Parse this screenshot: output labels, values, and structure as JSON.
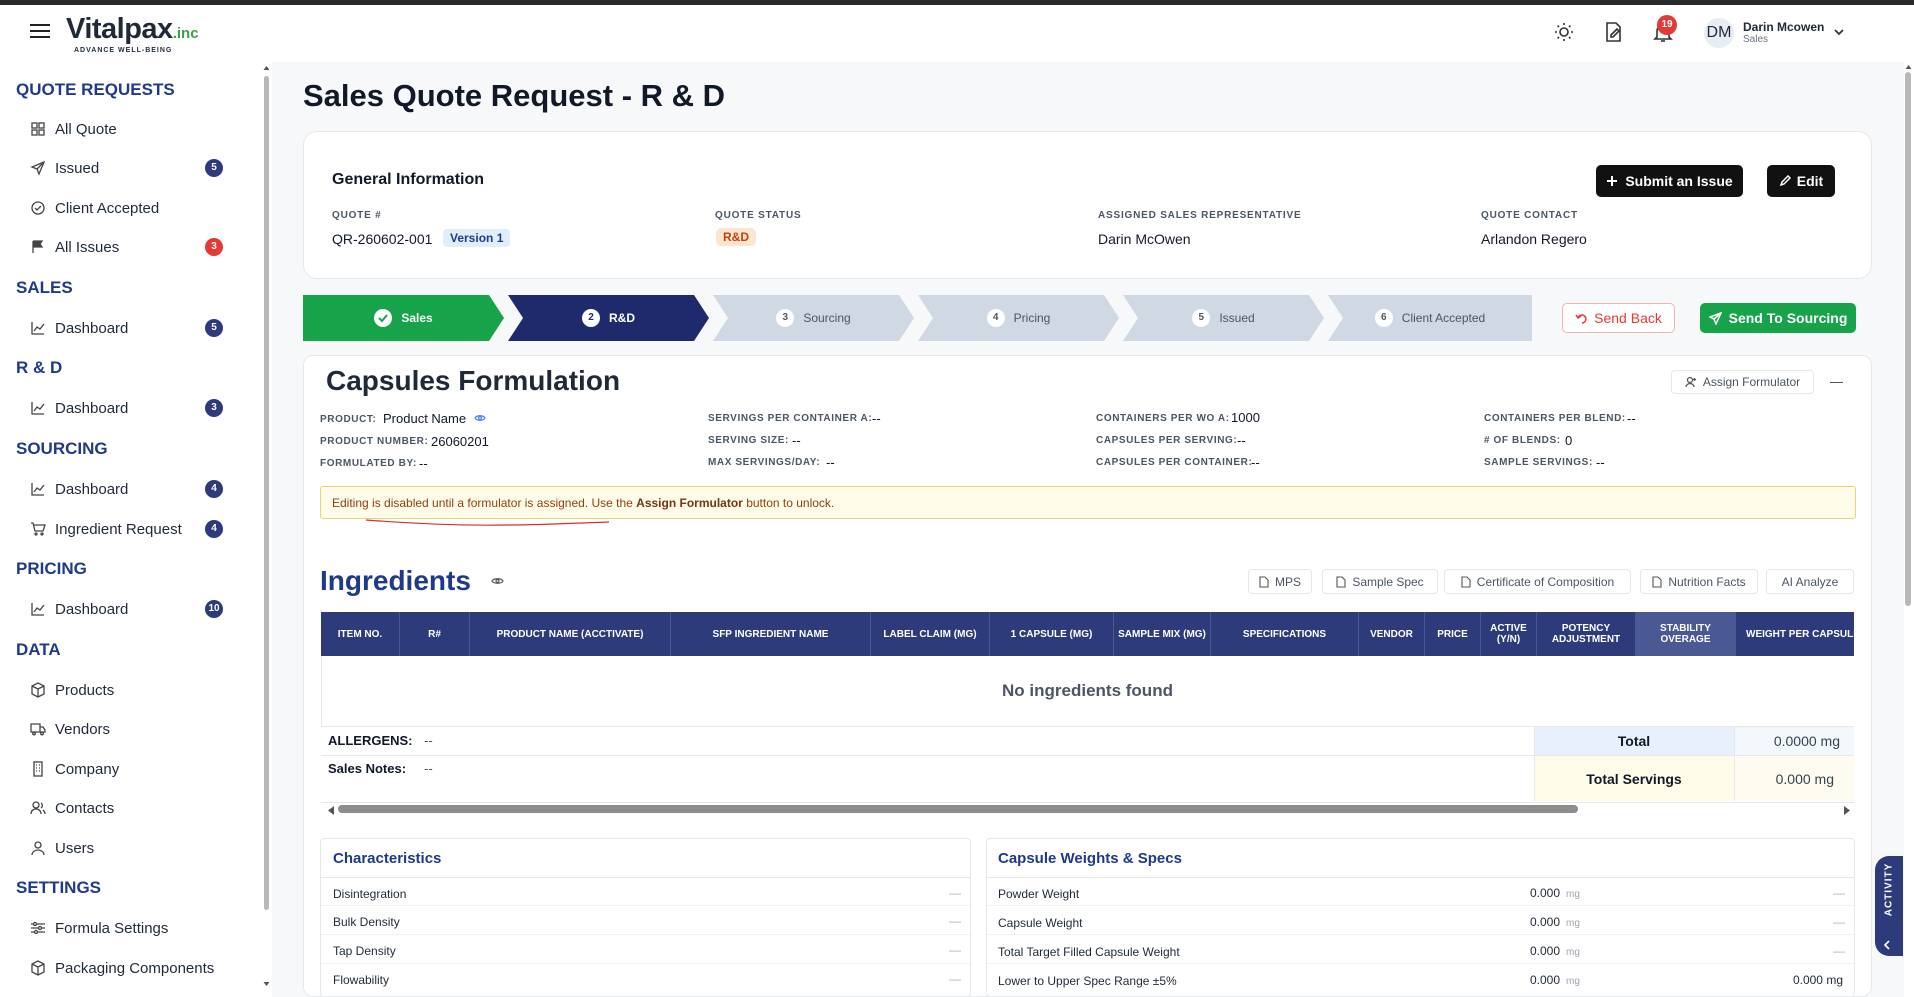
{
  "header": {
    "logo_text": "Vitalpax",
    "logo_suffix": ".inc",
    "logo_tagline": "ADVANCE WELL-BEING",
    "notification_count": "19",
    "user_initials": "DM",
    "user_name": "Darin Mcowen",
    "user_role": "Sales"
  },
  "sidebar": {
    "quote_requests": "QUOTE REQUESTS",
    "all_quote": "All Quote",
    "issued": "Issued",
    "issued_count": "5",
    "client_accepted": "Client Accepted",
    "all_issues": "All Issues",
    "all_issues_count": "3",
    "sales": "SALES",
    "sales_dashboard": "Dashboard",
    "sales_count": "5",
    "rnd": "R & D",
    "rnd_dashboard": "Dashboard",
    "rnd_count": "3",
    "sourcing": "SOURCING",
    "sourcing_dashboard": "Dashboard",
    "sourcing_count": "4",
    "ingredient_request": "Ingredient Request",
    "ingredient_request_count": "4",
    "pricing": "PRICING",
    "pricing_dashboard": "Dashboard",
    "pricing_count": "10",
    "data": "DATA",
    "products": "Products",
    "vendors": "Vendors",
    "company": "Company",
    "contacts": "Contacts",
    "users": "Users",
    "settings": "SETTINGS",
    "formula_settings": "Formula Settings",
    "packaging_components": "Packaging Components"
  },
  "page": {
    "title": "Sales Quote Request - R & D"
  },
  "general_info": {
    "title": "General Information",
    "submit_issue": "Submit an Issue",
    "edit": "Edit",
    "quote_no_label": "QUOTE #",
    "quote_no": "QR-260602-001",
    "version": "Version 1",
    "status_label": "QUOTE STATUS",
    "status": "R&D",
    "rep_label": "ASSIGNED SALES REPRESENTATIVE",
    "rep": "Darin McOwen",
    "contact_label": "QUOTE CONTACT",
    "contact": "Arlandon Regero"
  },
  "steps": [
    {
      "num": "",
      "label": "Sales"
    },
    {
      "num": "2",
      "label": "R&D"
    },
    {
      "num": "3",
      "label": "Sourcing"
    },
    {
      "num": "4",
      "label": "Pricing"
    },
    {
      "num": "5",
      "label": "Issued"
    },
    {
      "num": "6",
      "label": "Client Accepted"
    }
  ],
  "actions": {
    "send_back": "Send Back",
    "send_to_sourcing": "Send To Sourcing"
  },
  "formulation": {
    "title": "Capsules Formulation",
    "assign_formulator": "Assign Formulator",
    "product_label": "PRODUCT:",
    "product": "Product Name",
    "product_number_label": "PRODUCT NUMBER:",
    "product_number": "26060201",
    "formulated_by_label": "FORMULATED BY:",
    "formulated_by": "--",
    "servings_per_container_label": "SERVINGS PER CONTAINER A:",
    "servings_per_container": "--",
    "serving_size_label": "SERVING SIZE:",
    "serving_size": "--",
    "max_servings_label": "MAX SERVINGS/DAY:",
    "max_servings": "--",
    "containers_per_wo_label": "CONTAINERS PER WO A:",
    "containers_per_wo": "1000",
    "capsules_per_serving_label": "CAPSULES PER SERVING:",
    "capsules_per_serving": "--",
    "capsules_per_container_label": "CAPSULES PER CONTAINER:",
    "capsules_per_container": "--",
    "containers_per_blend_label": "CONTAINERS PER BLEND:",
    "containers_per_blend": "--",
    "num_blends_label": "# OF BLENDS:",
    "num_blends": "0",
    "sample_servings_label": "SAMPLE SERVINGS:",
    "sample_servings": "--",
    "warning_pre": "Editing is disabled until a formulator is assigned. Use the ",
    "warning_bold": "Assign Formulator",
    "warning_post": " button to unlock."
  },
  "ingredients": {
    "title": "Ingredients",
    "btn_mps": "MPS",
    "btn_sample_spec": "Sample Spec",
    "btn_coc": "Certificate of Composition",
    "btn_nutrition": "Nutrition Facts",
    "btn_ai": "AI Analyze",
    "columns": [
      "ITEM NO.",
      "R#",
      "PRODUCT NAME (ACCTIVATE)",
      "SFP INGREDIENT NAME",
      "LABEL CLAIM (MG)",
      "1 CAPSULE (MG)",
      "SAMPLE MIX (MG)",
      "SPECIFICATIONS",
      "VENDOR",
      "PRICE",
      "ACTIVE (Y/N)",
      "POTENCY ADJUSTMENT",
      "STABILITY OVERAGE",
      "WEIGHT PER CAPSULE (MG)"
    ],
    "empty": "No ingredients found",
    "allergens_label": "ALLERGENS:",
    "allergens": "--",
    "sales_notes_label": "Sales Notes:",
    "sales_notes": "--",
    "total_label": "Total",
    "total": "0.0000 mg",
    "total_servings_label": "Total Servings",
    "total_servings": "0.000 mg"
  },
  "characteristics": {
    "title": "Characteristics",
    "rows": [
      "Disintegration",
      "Bulk Density",
      "Tap Density",
      "Flowability"
    ],
    "empty": "—"
  },
  "capsule_specs": {
    "title": "Capsule Weights & Specs",
    "rows": [
      {
        "label": "Powder Weight",
        "value": "0.000",
        "unit": "mg",
        "extra": "—"
      },
      {
        "label": "Capsule Weight",
        "value": "0.000",
        "unit": "mg",
        "extra": "—"
      },
      {
        "label": "Total Target Filled Capsule Weight",
        "value": "0.000",
        "unit": "mg",
        "extra": "—"
      },
      {
        "label": "Lower to Upper Spec Range ±5%",
        "value": "0.000",
        "unit": "mg",
        "extra": "0.000 mg"
      }
    ]
  },
  "activity": {
    "label": "ACTIVITY"
  }
}
